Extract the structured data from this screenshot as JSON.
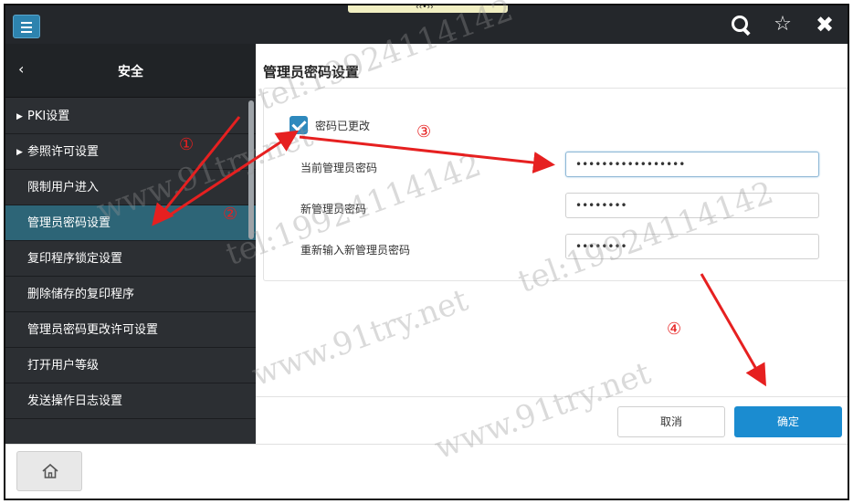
{
  "topbar": {
    "drag_handle_label": "‹‹•››",
    "icons": [
      "menu-icon",
      "search-icon",
      "star-icon",
      "close-icon"
    ],
    "accent_color": "#2d83ae"
  },
  "sidebar": {
    "title": "安全",
    "items": [
      {
        "label": "PKI设置",
        "expandable": true,
        "active": false
      },
      {
        "label": "参照许可设置",
        "expandable": true,
        "active": false
      },
      {
        "label": "限制用户进入",
        "expandable": false,
        "active": false
      },
      {
        "label": "管理员密码设置",
        "expandable": false,
        "active": true
      },
      {
        "label": "复印程序锁定设置",
        "expandable": false,
        "active": false
      },
      {
        "label": "删除储存的复印程序",
        "expandable": false,
        "active": false
      },
      {
        "label": "管理员密码更改许可设置",
        "expandable": false,
        "active": false
      },
      {
        "label": "打开用户等级",
        "expandable": false,
        "active": false
      },
      {
        "label": "发送操作日志设置",
        "expandable": false,
        "active": false
      }
    ]
  },
  "main": {
    "page_title": "管理员密码设置",
    "checkbox": {
      "label": "密码已更改",
      "checked": true
    },
    "fields": [
      {
        "label": "当前管理员密码",
        "value": "•••••••••••••••••"
      },
      {
        "label": "新管理员密码",
        "value": "••••••••"
      },
      {
        "label": "重新输入新管理员密码",
        "value": "••••••••"
      }
    ],
    "cancel_label": "取消",
    "ok_label": "确定"
  },
  "annotations": {
    "markers": [
      "①",
      "②",
      "③",
      "④"
    ],
    "arrow_color": "#e62020"
  },
  "watermarks": [
    "tel:19924114142",
    "www.91try.net"
  ]
}
